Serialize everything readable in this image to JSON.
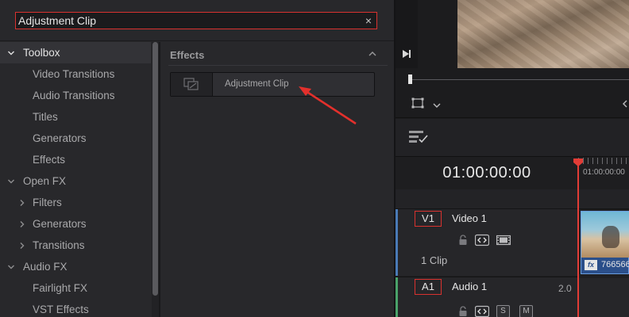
{
  "search": {
    "value": "Adjustment Clip",
    "clear_glyph": "×"
  },
  "toolbox_tree": [
    {
      "label": "Toolbox",
      "level": 0,
      "expander": "down",
      "selected": true
    },
    {
      "label": "Video Transitions",
      "level": 1,
      "expander": "none"
    },
    {
      "label": "Audio Transitions",
      "level": 1,
      "expander": "none"
    },
    {
      "label": "Titles",
      "level": 1,
      "expander": "none"
    },
    {
      "label": "Generators",
      "level": 1,
      "expander": "none"
    },
    {
      "label": "Effects",
      "level": 1,
      "expander": "none"
    },
    {
      "label": "Open FX",
      "level": 0,
      "expander": "down"
    },
    {
      "label": "Filters",
      "level": 1,
      "expander": "right"
    },
    {
      "label": "Generators",
      "level": 1,
      "expander": "right"
    },
    {
      "label": "Transitions",
      "level": 1,
      "expander": "right"
    },
    {
      "label": "Audio FX",
      "level": 0,
      "expander": "down"
    },
    {
      "label": "Fairlight FX",
      "level": 1,
      "expander": "none"
    },
    {
      "label": "VST Effects",
      "level": 1,
      "expander": "none"
    }
  ],
  "effects_panel": {
    "header": "Effects",
    "items": [
      {
        "label": "Adjustment Clip",
        "icon": "adjustment-clip-icon"
      }
    ]
  },
  "timeline": {
    "timecode": "01:00:00:00",
    "ruler_label": "01:00:00:00",
    "tracks": {
      "video": {
        "badge": "V1",
        "name": "Video 1",
        "clip_count": "1 Clip"
      },
      "audio": {
        "badge": "A1",
        "name": "Audio 1",
        "level": "2.0",
        "solo": "S",
        "mute": "M"
      }
    },
    "clip": {
      "fx_badge": "fx",
      "name": "766566"
    }
  },
  "colors": {
    "accent_red": "#d9322f",
    "playhead": "#e23c36",
    "video_track": "#4a7bb7",
    "audio_track": "#4aa36a",
    "clip_blue": "#2b4f8a"
  }
}
